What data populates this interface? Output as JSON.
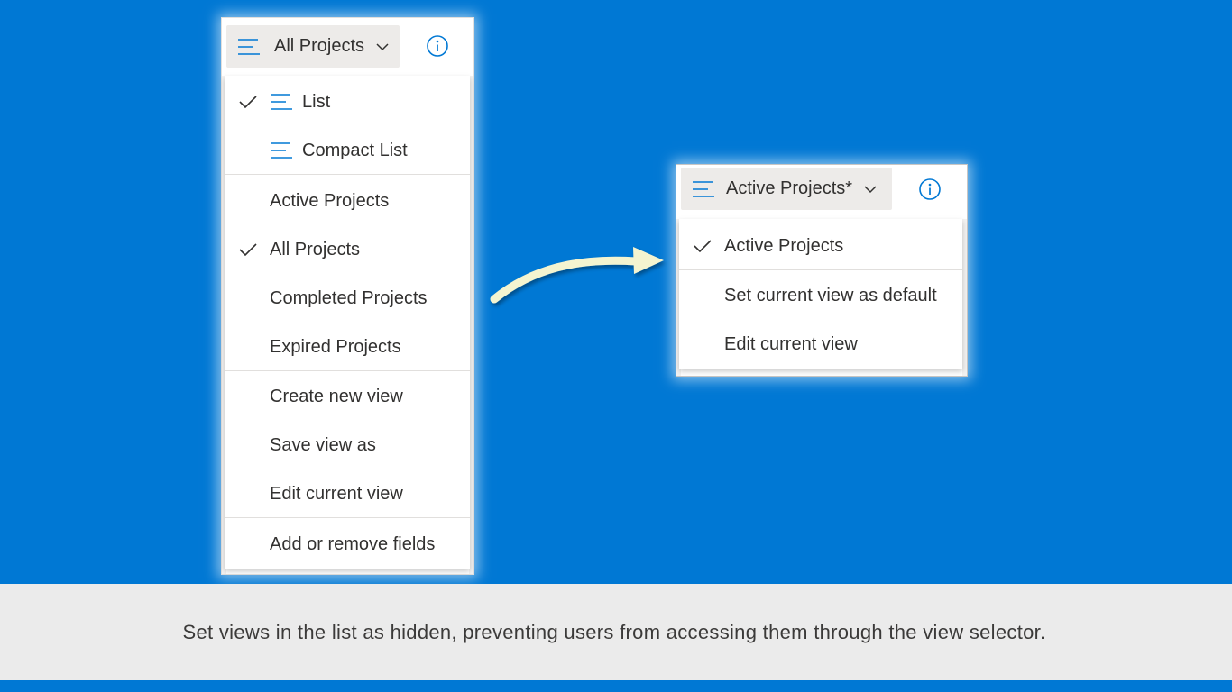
{
  "left_panel": {
    "view_button_label": "All Projects",
    "menu": {
      "layout_items": [
        {
          "label": "List",
          "checked": true,
          "icon": "list-lines-icon"
        },
        {
          "label": "Compact List",
          "checked": false,
          "icon": "list-lines-icon"
        }
      ],
      "view_items": [
        {
          "label": "Active Projects",
          "checked": false
        },
        {
          "label": "All Projects",
          "checked": true
        },
        {
          "label": "Completed Projects",
          "checked": false
        },
        {
          "label": "Expired Projects",
          "checked": false
        }
      ],
      "action_items": [
        {
          "label": "Create new view"
        },
        {
          "label": "Save view as"
        },
        {
          "label": "Edit current view"
        }
      ],
      "fields_item": {
        "label": "Add or remove fields"
      }
    }
  },
  "right_panel": {
    "view_button_label": "Active Projects*",
    "menu": {
      "view_items": [
        {
          "label": "Active Projects",
          "checked": true
        }
      ],
      "action_items": [
        {
          "label": "Set current view as default"
        },
        {
          "label": "Edit current view"
        }
      ]
    }
  },
  "caption": "Set views in the list as hidden, preventing users from accessing them through the view selector.",
  "colors": {
    "background": "#0078d4",
    "accent": "#0078d4",
    "caption_bar": "#ebebeb",
    "arrow": "#f4f4d0"
  },
  "icons": [
    "list-lines-icon",
    "chevron-down-icon",
    "info-icon",
    "checkmark-icon",
    "curved-arrow-icon"
  ]
}
